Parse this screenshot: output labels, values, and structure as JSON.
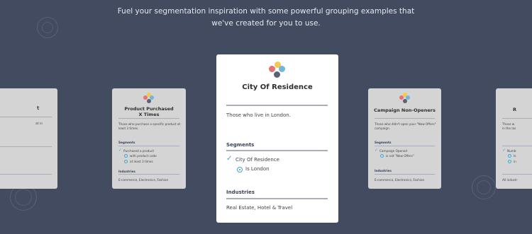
{
  "intro": {
    "line1": "Fuel your segmentation inspiration with some powerful grouping examples that",
    "line2": "we've created for you to use."
  },
  "colors": {
    "background": "#434b61",
    "accent": "#4aa3c7",
    "logo": [
      "#e57373",
      "#f6c94e",
      "#6fb7dc",
      "#5b6178"
    ]
  },
  "cards": {
    "left_edge": {
      "title_part": "t",
      "desc_part": "at in"
    },
    "product": {
      "title_line1": "Product Purchased",
      "title_line2": "X Times",
      "description_line1": "Those who purchase a specific product at",
      "description_line2": "least 3 times.",
      "segments_heading": "Segments",
      "segment": "Purchased a product",
      "condition1": "with product code",
      "condition2": "at least 3 times",
      "industries_heading": "Industries",
      "industries": "E-commerce, Electronics, Fashion"
    },
    "city": {
      "title": "City Of Residence",
      "description": "Those who live in London.",
      "segments_heading": "Segments",
      "segment": "City Of Residence",
      "condition": "Is London",
      "industries_heading": "Industries",
      "industries": "Real Estate, Hotel & Travel"
    },
    "campaign": {
      "title": "Campaign Non-Openers",
      "description_line1": "Those who didn't open your \"New Offers\"",
      "description_line2": "campaign.",
      "segments_heading": "Segments",
      "segment": "Campaign Opened",
      "condition": "is not \"New Offers\"",
      "industries_heading": "Industries",
      "industries": "E-commerce, Electronics, Fashion"
    },
    "right_edge": {
      "title_part": "R",
      "desc_line1": "Those w",
      "desc_line2": "in the las",
      "segment_part": "Numb",
      "condition1_part": "Is",
      "condition2_part": "in",
      "industries_part": "All industr"
    }
  }
}
